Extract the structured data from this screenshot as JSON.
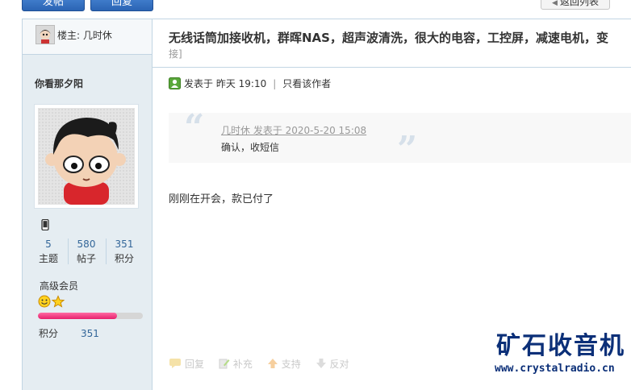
{
  "toolbar": {
    "post_label": "发帖",
    "reply_label": "回复",
    "back_label": "返回列表"
  },
  "thread": {
    "op_label": "楼主: 几时休",
    "title": "无线话筒加接收机，群晖NAS，超声波清洗，很大的电容，工控屏，减速电机，变",
    "title_cont": "接]"
  },
  "user": {
    "name": "你看那夕阳",
    "stats": [
      {
        "value": "5",
        "label": "主题"
      },
      {
        "value": "580",
        "label": "帖子"
      },
      {
        "value": "351",
        "label": "积分"
      }
    ],
    "level": "高级会员",
    "level_progress": 0.75,
    "score_label": "积分",
    "score_value": "351"
  },
  "post": {
    "meta": "发表于 昨天 19:10",
    "author_only": "只看该作者",
    "quote_author": "几时休 发表于 2020-5-20 15:08",
    "quote_text": "确认，收短信",
    "content": "刚刚在开会，款已付了"
  },
  "actions": {
    "reply": "回复",
    "supplement": "补充",
    "support": "支持",
    "oppose": "反对"
  },
  "watermark": {
    "title": "矿石收音机",
    "url": "www.crystalradio.cn"
  },
  "colors": {
    "link": "#336699",
    "sidebar_bg": "#e5edf2",
    "border": "#c2d5e3",
    "watermark": "#0b2f78"
  }
}
